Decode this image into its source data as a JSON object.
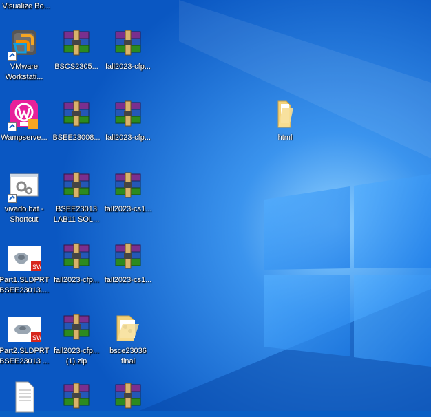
{
  "desktop": {
    "wallpaper_colors": {
      "base": "#0a5fc4",
      "light": "#5fb3ff",
      "window": "#2b8ef0"
    },
    "icons": [
      {
        "label": "Visualize Bo...",
        "icon": "app-icon"
      },
      {
        "label": "VMware\nWorkstati...",
        "icon": "vmware-icon"
      },
      {
        "label": "BSCS2305...",
        "icon": "winrar-archive-icon"
      },
      {
        "label": "fall2023-cfp...",
        "icon": "winrar-archive-icon"
      },
      {
        "label": "Wampserve...",
        "icon": "wampserver-icon"
      },
      {
        "label": "BSEE23008...",
        "icon": "winrar-archive-icon"
      },
      {
        "label": "fall2023-cfp...",
        "icon": "winrar-archive-icon"
      },
      {
        "label": "html",
        "icon": "folder-icon"
      },
      {
        "label": "vivado.bat -\nShortcut",
        "icon": "batch-file-icon"
      },
      {
        "label": "BSEE23013\nLAB11 SOL...",
        "icon": "winrar-archive-icon"
      },
      {
        "label": "fall2023-cs1...",
        "icon": "winrar-archive-icon"
      },
      {
        "label": "Part1.SLDPRT\nBSEE23013....",
        "icon": "solidworks-part-icon"
      },
      {
        "label": "fall2023-cfp...",
        "icon": "winrar-archive-icon"
      },
      {
        "label": "fall2023-cs1...",
        "icon": "winrar-archive-icon"
      },
      {
        "label": "Part2.SLDPRT\nBSEE23013 ...",
        "icon": "solidworks-part-icon"
      },
      {
        "label": "fall2023-cfp...\n(1).zip",
        "icon": "winrar-archive-icon"
      },
      {
        "label": "bsce23036\nfinal",
        "icon": "folder-icon"
      },
      {
        "label": "",
        "icon": "text-document-icon"
      },
      {
        "label": "",
        "icon": "winrar-archive-icon"
      },
      {
        "label": "",
        "icon": "winrar-archive-icon"
      }
    ]
  }
}
